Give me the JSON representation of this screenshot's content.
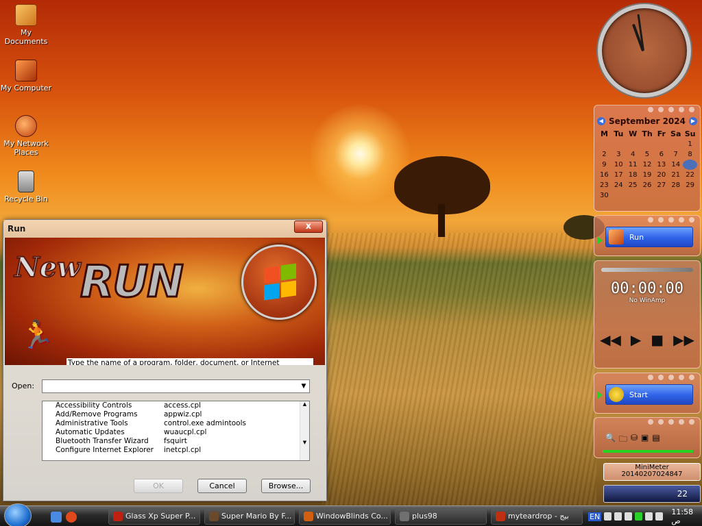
{
  "desktop": {
    "icons": [
      {
        "label": "My Documents",
        "icon": "folder-icon"
      },
      {
        "label": "My Computer",
        "icon": "computer-icon"
      },
      {
        "label": "My Network Places",
        "icon": "network-icon"
      },
      {
        "label": "Recycle Bin",
        "icon": "recycle-bin-icon"
      }
    ]
  },
  "calendar": {
    "month": "September 2024",
    "weekdays": [
      "M",
      "Tu",
      "W",
      "Th",
      "Fr",
      "Sa",
      "Su"
    ],
    "today": 15
  },
  "run_gadget": {
    "label": "Run"
  },
  "winamp": {
    "time": "00:00:00",
    "status": "No WinAmp"
  },
  "start_gadget": {
    "label": "Start"
  },
  "minimeter": {
    "title": "MiniMeter",
    "value": "20140207024847"
  },
  "mini_taskbar": {
    "time": "22"
  },
  "dialog": {
    "title": "Run",
    "banner_new": "New",
    "banner_run": "RUN",
    "description": "Type the name of a program, folder, document, or Internet resource, and Windows will open it for you.",
    "open_label": "Open:",
    "open_value": "",
    "list": [
      {
        "name": "Accessibility Controls",
        "command": "access.cpl"
      },
      {
        "name": "Add/Remove Programs",
        "command": "appwiz.cpl"
      },
      {
        "name": "Administrative Tools",
        "command": "control.exe admintools"
      },
      {
        "name": "Automatic Updates",
        "command": "wuaucpl.cpl"
      },
      {
        "name": "Bluetooth Transfer Wizard",
        "command": "fsquirt"
      },
      {
        "name": "Configure Internet Explorer",
        "command": "inetcpl.cpl"
      }
    ],
    "ok": "OK",
    "cancel": "Cancel",
    "browse": "Browse...",
    "close": "x"
  },
  "taskbar": {
    "buttons": [
      {
        "label": "Glass Xp Super P..."
      },
      {
        "label": "Super Mario By F..."
      },
      {
        "label": "WindowBlinds Co..."
      },
      {
        "label": "plus98"
      },
      {
        "label": "myteardrop - بيج"
      }
    ],
    "lang": "EN",
    "time": "11:58 ص"
  },
  "colors": {
    "accent": "#2f62e6",
    "sunset": "#f08a1c",
    "green_arrow": "#2ad02a"
  }
}
